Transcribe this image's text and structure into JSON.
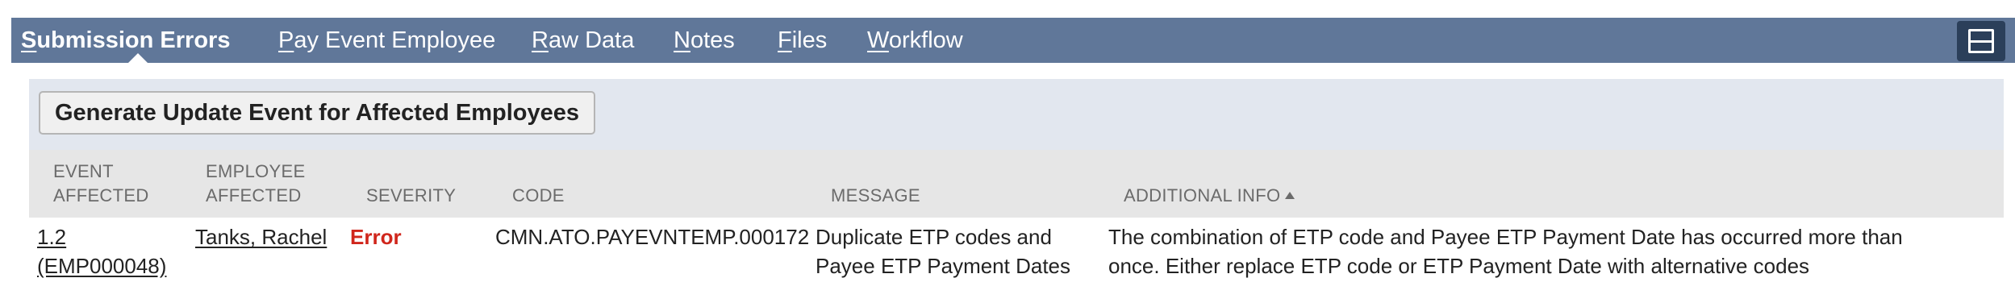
{
  "tabs": [
    {
      "underline": "S",
      "rest": "ubmission Errors",
      "active": true
    },
    {
      "underline": "P",
      "rest": "ay Event Employee",
      "active": false
    },
    {
      "underline": "R",
      "rest": "aw Data",
      "active": false
    },
    {
      "underline": "N",
      "rest": "otes",
      "active": false
    },
    {
      "underline": "F",
      "rest": "iles",
      "active": false
    },
    {
      "underline": "W",
      "rest": "orkflow",
      "active": false
    }
  ],
  "toolbar": {
    "layout_icon": "layout-toggle-icon",
    "generate_label": "Generate Update Event for Affected Employees"
  },
  "table": {
    "headers": {
      "event_line1": "EVENT",
      "event_line2": "AFFECTED",
      "employee_line1": "EMPLOYEE",
      "employee_line2": "AFFECTED",
      "severity": "SEVERITY",
      "code": "CODE",
      "message": "MESSAGE",
      "additional": "ADDITIONAL INFO"
    },
    "sort": {
      "column": "additional",
      "direction": "ascending"
    },
    "rows": [
      {
        "event_line1": "1.2",
        "event_line2": "(EMP000048)",
        "employee": "Tanks, Rachel",
        "severity": "Error",
        "code": "CMN.ATO.PAYEVNTEMP.000172",
        "message_line1": "Duplicate ETP codes and",
        "message_line2": "Payee ETP Payment Dates",
        "additional_line1": "The combination of ETP code and Payee ETP Payment Date has occurred more than",
        "additional_line2": "once. Either replace ETP code or ETP Payment Date with alternative codes"
      }
    ]
  },
  "colors": {
    "tabbar": "#607799",
    "actionbar": "#e2e7ef",
    "header": "#e6e6e6",
    "error": "#d0261c"
  }
}
